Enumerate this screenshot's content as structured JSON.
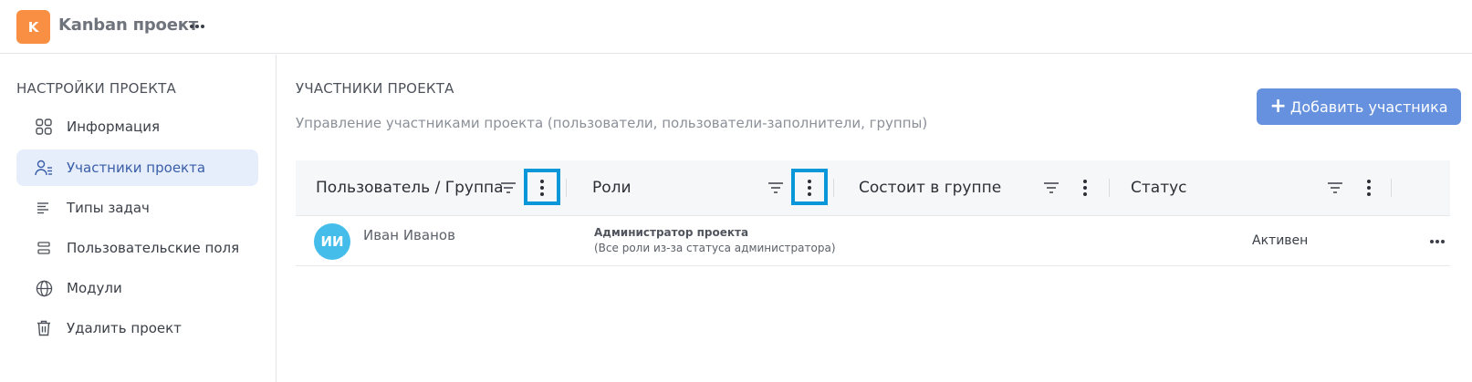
{
  "header": {
    "logo_letter": "K",
    "project_name": "Kanban проект",
    "logo_color": "#f98f43"
  },
  "sidebar": {
    "title": "НАСТРОЙКИ ПРОЕКТА",
    "items": [
      {
        "label": "Информация",
        "icon": "grid-icon",
        "active": false
      },
      {
        "label": "Участники проекта",
        "icon": "users-icon",
        "active": true
      },
      {
        "label": "Типы задач",
        "icon": "list-icon",
        "active": false
      },
      {
        "label": "Пользовательские поля",
        "icon": "fields-icon",
        "active": false
      },
      {
        "label": "Модули",
        "icon": "globe-icon",
        "active": false
      },
      {
        "label": "Удалить проект",
        "icon": "trash-icon",
        "active": false
      }
    ]
  },
  "main": {
    "title": "УЧАСТНИКИ ПРОЕКТА",
    "subtitle": "Управление участниками проекта (пользователи, пользователи-заполнители, группы)",
    "add_button_label": "Добавить участника",
    "add_button_color": "#6691de",
    "table": {
      "columns": [
        {
          "label": "Пользователь / Группа",
          "highlighted": true
        },
        {
          "label": "Роли",
          "highlighted": true
        },
        {
          "label": "Состоит в группе",
          "highlighted": false
        },
        {
          "label": "Статус",
          "highlighted": false
        }
      ],
      "rows": [
        {
          "avatar_initials": "ИИ",
          "name": "Иван Иванов",
          "role_title": "Администратор проекта",
          "role_note": "(Все роли из-за статуса администратора)",
          "group": "",
          "status": "Активен"
        }
      ]
    },
    "highlight_color": "#0a97d9",
    "avatar_color": "#45bdea"
  }
}
